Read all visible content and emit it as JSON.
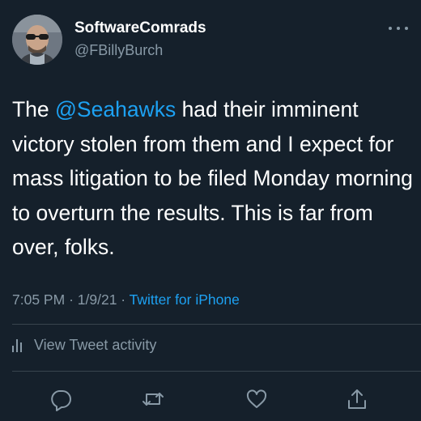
{
  "user": {
    "display_name": "SoftwareComrads",
    "handle": "@FBillyBurch"
  },
  "tweet": {
    "text_before_mention": "The ",
    "mention": "@Seahawks",
    "text_after_mention": " had their imminent victory stolen from them and I expect for mass litigation to be filed Monday morning to overturn the results. This is far from over, folks.",
    "time": "7:05 PM",
    "separator": "·",
    "date": "1/9/21",
    "source": "Twitter for iPhone"
  },
  "activity": {
    "label": "View Tweet activity",
    "icon": "bar-chart-icon"
  },
  "actions": [
    {
      "name": "reply",
      "icon": "reply-icon"
    },
    {
      "name": "retweet",
      "icon": "retweet-icon"
    },
    {
      "name": "like",
      "icon": "heart-icon"
    },
    {
      "name": "share",
      "icon": "share-icon"
    }
  ],
  "colors": {
    "background": "#15202b",
    "text": "#ffffff",
    "secondary": "#8899a6",
    "accent": "#1da1f2",
    "divider": "#38444d"
  }
}
